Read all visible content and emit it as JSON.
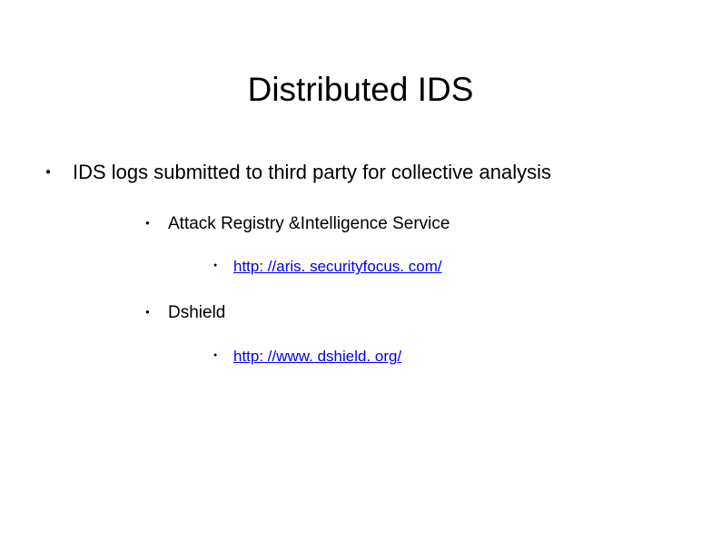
{
  "title": "Distributed IDS",
  "bullets": {
    "main": "IDS logs submitted to third party for collective analysis",
    "sub1": "Attack Registry &Intelligence Service",
    "sub1_link": "http: //aris. securityfocus. com/",
    "sub2": "Dshield",
    "sub2_link": "http: //www. dshield. org/"
  }
}
